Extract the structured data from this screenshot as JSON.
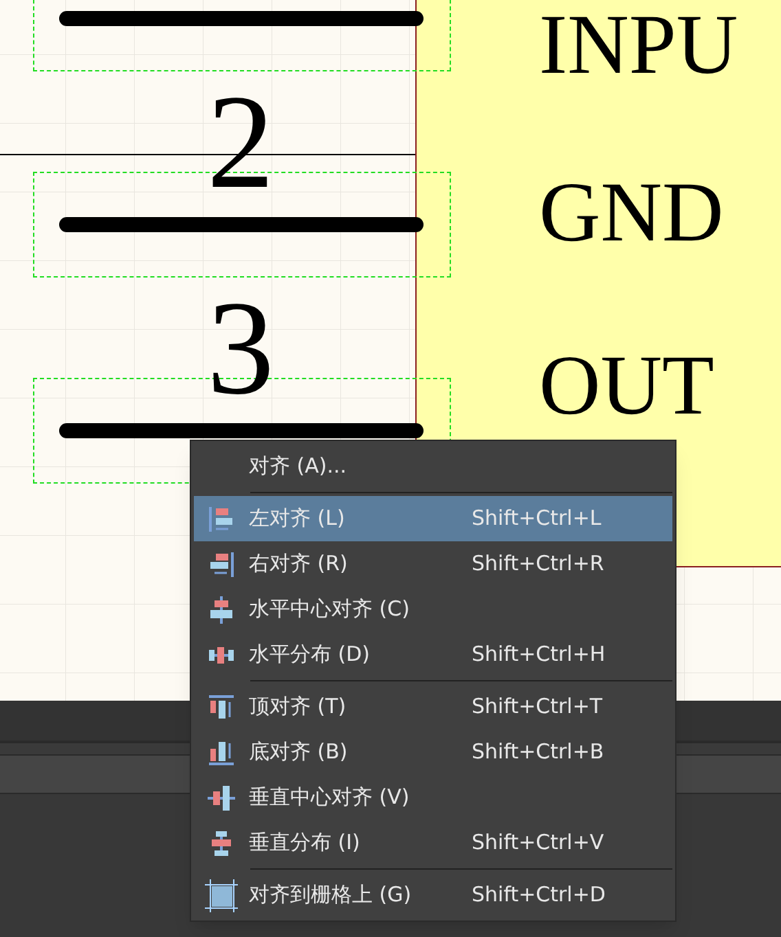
{
  "schematic": {
    "pins": [
      {
        "name": "INPU"
      },
      {
        "number": "2",
        "name": "GND"
      },
      {
        "number": "3",
        "name": "OUT"
      }
    ]
  },
  "context_menu": {
    "items": [
      {
        "kind": "item",
        "label": "对齐 (A)...",
        "selected": false
      },
      {
        "kind": "separator"
      },
      {
        "kind": "item",
        "label": "左对齐 (L)",
        "shortcut": "Shift+Ctrl+L",
        "selected": true
      },
      {
        "kind": "item",
        "label": "右对齐 (R)",
        "shortcut": "Shift+Ctrl+R",
        "selected": false
      },
      {
        "kind": "item",
        "label": "水平中心对齐 (C)",
        "selected": false
      },
      {
        "kind": "item",
        "label": "水平分布 (D)",
        "shortcut": "Shift+Ctrl+H",
        "selected": false
      },
      {
        "kind": "separator"
      },
      {
        "kind": "item",
        "label": "顶对齐 (T)",
        "shortcut": "Shift+Ctrl+T",
        "selected": false
      },
      {
        "kind": "item",
        "label": "底对齐 (B)",
        "shortcut": "Shift+Ctrl+B",
        "selected": false
      },
      {
        "kind": "item",
        "label": "垂直中心对齐 (V)",
        "selected": false
      },
      {
        "kind": "item",
        "label": "垂直分布 (I)",
        "shortcut": "Shift+Ctrl+V",
        "selected": false
      },
      {
        "kind": "separator"
      },
      {
        "kind": "item",
        "label": "对齐到栅格上 (G)",
        "shortcut": "Shift+Ctrl+D",
        "selected": false
      }
    ]
  }
}
